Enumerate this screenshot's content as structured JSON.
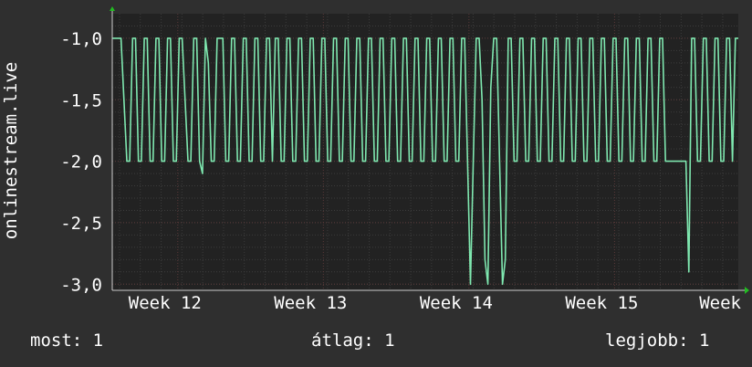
{
  "chart_data": {
    "type": "line",
    "ylabel": "onlinestream.live",
    "ylim": [
      -3.05,
      -0.8
    ],
    "yticks": [
      {
        "value": -1.0,
        "label": "-1,0"
      },
      {
        "value": -1.5,
        "label": "-1,5"
      },
      {
        "value": -2.0,
        "label": "-2,0"
      },
      {
        "value": -2.5,
        "label": "-2,5"
      },
      {
        "value": -3.0,
        "label": "-3,0"
      }
    ],
    "xlim": [
      11.55,
      15.85
    ],
    "xticks": [
      {
        "value": 12,
        "label": "Week 12"
      },
      {
        "value": 13,
        "label": "Week 13"
      },
      {
        "value": 14,
        "label": "Week 14"
      },
      {
        "value": 15,
        "label": "Week 15"
      },
      {
        "value": 15.85,
        "label": "Week"
      }
    ],
    "grid": true,
    "series": [
      {
        "color": "#7fe8b0",
        "points": [
          [
            11.55,
            -1.0
          ],
          [
            11.61,
            -1.0
          ],
          [
            11.63,
            -1.5
          ],
          [
            11.65,
            -2.0
          ],
          [
            11.67,
            -2.0
          ],
          [
            11.69,
            -1.0
          ],
          [
            11.71,
            -1.0
          ],
          [
            11.73,
            -2.0
          ],
          [
            11.75,
            -2.0
          ],
          [
            11.77,
            -1.0
          ],
          [
            11.79,
            -1.0
          ],
          [
            11.81,
            -2.0
          ],
          [
            11.83,
            -2.0
          ],
          [
            11.85,
            -1.0
          ],
          [
            11.87,
            -1.0
          ],
          [
            11.89,
            -2.0
          ],
          [
            11.91,
            -2.0
          ],
          [
            11.93,
            -1.0
          ],
          [
            11.95,
            -1.0
          ],
          [
            11.97,
            -2.0
          ],
          [
            11.99,
            -2.0
          ],
          [
            12.01,
            -1.0
          ],
          [
            12.03,
            -1.0
          ],
          [
            12.05,
            -1.5
          ],
          [
            12.07,
            -2.0
          ],
          [
            12.09,
            -2.0
          ],
          [
            12.11,
            -1.0
          ],
          [
            12.13,
            -1.0
          ],
          [
            12.15,
            -2.0
          ],
          [
            12.17,
            -2.1
          ],
          [
            12.19,
            -1.0
          ],
          [
            12.21,
            -1.2
          ],
          [
            12.23,
            -2.0
          ],
          [
            12.25,
            -2.0
          ],
          [
            12.27,
            -1.0
          ],
          [
            12.31,
            -1.0
          ],
          [
            12.33,
            -2.0
          ],
          [
            12.35,
            -2.0
          ],
          [
            12.37,
            -1.0
          ],
          [
            12.39,
            -1.0
          ],
          [
            12.41,
            -2.0
          ],
          [
            12.43,
            -2.0
          ],
          [
            12.45,
            -1.0
          ],
          [
            12.47,
            -1.0
          ],
          [
            12.49,
            -2.0
          ],
          [
            12.51,
            -2.0
          ],
          [
            12.53,
            -1.0
          ],
          [
            12.55,
            -1.0
          ],
          [
            12.57,
            -2.0
          ],
          [
            12.59,
            -2.0
          ],
          [
            12.61,
            -1.0
          ],
          [
            12.63,
            -1.0
          ],
          [
            12.65,
            -2.0
          ],
          [
            12.67,
            -1.0
          ],
          [
            12.69,
            -1.0
          ],
          [
            12.71,
            -2.0
          ],
          [
            12.73,
            -2.0
          ],
          [
            12.75,
            -1.0
          ],
          [
            12.77,
            -1.0
          ],
          [
            12.79,
            -2.0
          ],
          [
            12.81,
            -2.0
          ],
          [
            12.83,
            -1.0
          ],
          [
            12.85,
            -1.0
          ],
          [
            12.87,
            -2.0
          ],
          [
            12.89,
            -2.0
          ],
          [
            12.91,
            -1.0
          ],
          [
            12.93,
            -1.0
          ],
          [
            12.95,
            -2.0
          ],
          [
            12.97,
            -2.0
          ],
          [
            12.99,
            -1.0
          ],
          [
            13.01,
            -1.0
          ],
          [
            13.03,
            -2.0
          ],
          [
            13.05,
            -2.0
          ],
          [
            13.07,
            -1.0
          ],
          [
            13.09,
            -1.0
          ],
          [
            13.11,
            -2.0
          ],
          [
            13.13,
            -2.0
          ],
          [
            13.15,
            -1.0
          ],
          [
            13.17,
            -1.0
          ],
          [
            13.19,
            -2.0
          ],
          [
            13.21,
            -2.0
          ],
          [
            13.23,
            -1.0
          ],
          [
            13.25,
            -1.0
          ],
          [
            13.27,
            -2.0
          ],
          [
            13.29,
            -2.0
          ],
          [
            13.31,
            -1.0
          ],
          [
            13.33,
            -1.0
          ],
          [
            13.35,
            -2.0
          ],
          [
            13.37,
            -2.0
          ],
          [
            13.39,
            -1.0
          ],
          [
            13.41,
            -1.0
          ],
          [
            13.43,
            -2.0
          ],
          [
            13.45,
            -2.0
          ],
          [
            13.47,
            -1.0
          ],
          [
            13.49,
            -1.0
          ],
          [
            13.51,
            -2.0
          ],
          [
            13.53,
            -2.0
          ],
          [
            13.55,
            -1.0
          ],
          [
            13.57,
            -1.0
          ],
          [
            13.59,
            -2.0
          ],
          [
            13.61,
            -2.0
          ],
          [
            13.63,
            -1.0
          ],
          [
            13.65,
            -1.0
          ],
          [
            13.67,
            -2.0
          ],
          [
            13.69,
            -2.0
          ],
          [
            13.71,
            -1.0
          ],
          [
            13.73,
            -1.0
          ],
          [
            13.75,
            -2.0
          ],
          [
            13.77,
            -2.0
          ],
          [
            13.79,
            -1.0
          ],
          [
            13.81,
            -1.0
          ],
          [
            13.83,
            -2.0
          ],
          [
            13.85,
            -2.0
          ],
          [
            13.87,
            -1.0
          ],
          [
            13.89,
            -1.0
          ],
          [
            13.91,
            -2.0
          ],
          [
            13.93,
            -2.0
          ],
          [
            13.95,
            -1.0
          ],
          [
            13.97,
            -1.0
          ],
          [
            13.99,
            -2.0
          ],
          [
            14.01,
            -3.0
          ],
          [
            14.03,
            -2.0
          ],
          [
            14.05,
            -1.0
          ],
          [
            14.07,
            -1.0
          ],
          [
            14.09,
            -1.5
          ],
          [
            14.11,
            -2.8
          ],
          [
            14.13,
            -3.0
          ],
          [
            14.15,
            -1.4
          ],
          [
            14.17,
            -1.0
          ],
          [
            14.19,
            -1.0
          ],
          [
            14.21,
            -2.0
          ],
          [
            14.23,
            -3.0
          ],
          [
            14.25,
            -2.8
          ],
          [
            14.27,
            -1.0
          ],
          [
            14.29,
            -1.0
          ],
          [
            14.31,
            -2.0
          ],
          [
            14.33,
            -2.0
          ],
          [
            14.35,
            -1.0
          ],
          [
            14.37,
            -1.0
          ],
          [
            14.39,
            -2.0
          ],
          [
            14.41,
            -2.0
          ],
          [
            14.43,
            -1.0
          ],
          [
            14.45,
            -1.0
          ],
          [
            14.47,
            -2.0
          ],
          [
            14.49,
            -2.0
          ],
          [
            14.51,
            -1.0
          ],
          [
            14.53,
            -1.0
          ],
          [
            14.55,
            -2.0
          ],
          [
            14.57,
            -2.0
          ],
          [
            14.59,
            -1.0
          ],
          [
            14.61,
            -1.0
          ],
          [
            14.63,
            -2.0
          ],
          [
            14.65,
            -2.0
          ],
          [
            14.67,
            -1.0
          ],
          [
            14.69,
            -1.0
          ],
          [
            14.71,
            -2.0
          ],
          [
            14.73,
            -2.0
          ],
          [
            14.75,
            -1.0
          ],
          [
            14.77,
            -1.0
          ],
          [
            14.79,
            -2.0
          ],
          [
            14.81,
            -2.0
          ],
          [
            14.83,
            -1.0
          ],
          [
            14.85,
            -1.0
          ],
          [
            14.87,
            -2.0
          ],
          [
            14.89,
            -2.0
          ],
          [
            14.91,
            -1.0
          ],
          [
            14.93,
            -1.0
          ],
          [
            14.95,
            -2.0
          ],
          [
            14.97,
            -2.0
          ],
          [
            14.99,
            -1.0
          ],
          [
            15.01,
            -1.0
          ],
          [
            15.03,
            -2.0
          ],
          [
            15.05,
            -2.0
          ],
          [
            15.07,
            -1.0
          ],
          [
            15.09,
            -1.0
          ],
          [
            15.11,
            -2.0
          ],
          [
            15.13,
            -2.0
          ],
          [
            15.15,
            -1.0
          ],
          [
            15.17,
            -1.0
          ],
          [
            15.19,
            -2.0
          ],
          [
            15.21,
            -2.0
          ],
          [
            15.23,
            -1.0
          ],
          [
            15.25,
            -1.0
          ],
          [
            15.27,
            -2.0
          ],
          [
            15.29,
            -2.0
          ],
          [
            15.31,
            -1.0
          ],
          [
            15.33,
            -1.0
          ],
          [
            15.35,
            -2.0
          ],
          [
            15.49,
            -2.0
          ],
          [
            15.51,
            -2.9
          ],
          [
            15.53,
            -1.0
          ],
          [
            15.55,
            -1.0
          ],
          [
            15.57,
            -2.0
          ],
          [
            15.59,
            -2.0
          ],
          [
            15.61,
            -1.0
          ],
          [
            15.63,
            -1.0
          ],
          [
            15.65,
            -2.0
          ],
          [
            15.67,
            -2.0
          ],
          [
            15.69,
            -1.0
          ],
          [
            15.71,
            -1.0
          ],
          [
            15.73,
            -2.0
          ],
          [
            15.75,
            -2.0
          ],
          [
            15.77,
            -1.0
          ],
          [
            15.79,
            -1.0
          ],
          [
            15.81,
            -2.0
          ],
          [
            15.83,
            -1.0
          ],
          [
            15.85,
            -1.0
          ]
        ]
      }
    ]
  },
  "footer": {
    "current": "most: 1",
    "average": "átlag: 1",
    "best": "legjobb: 1"
  }
}
